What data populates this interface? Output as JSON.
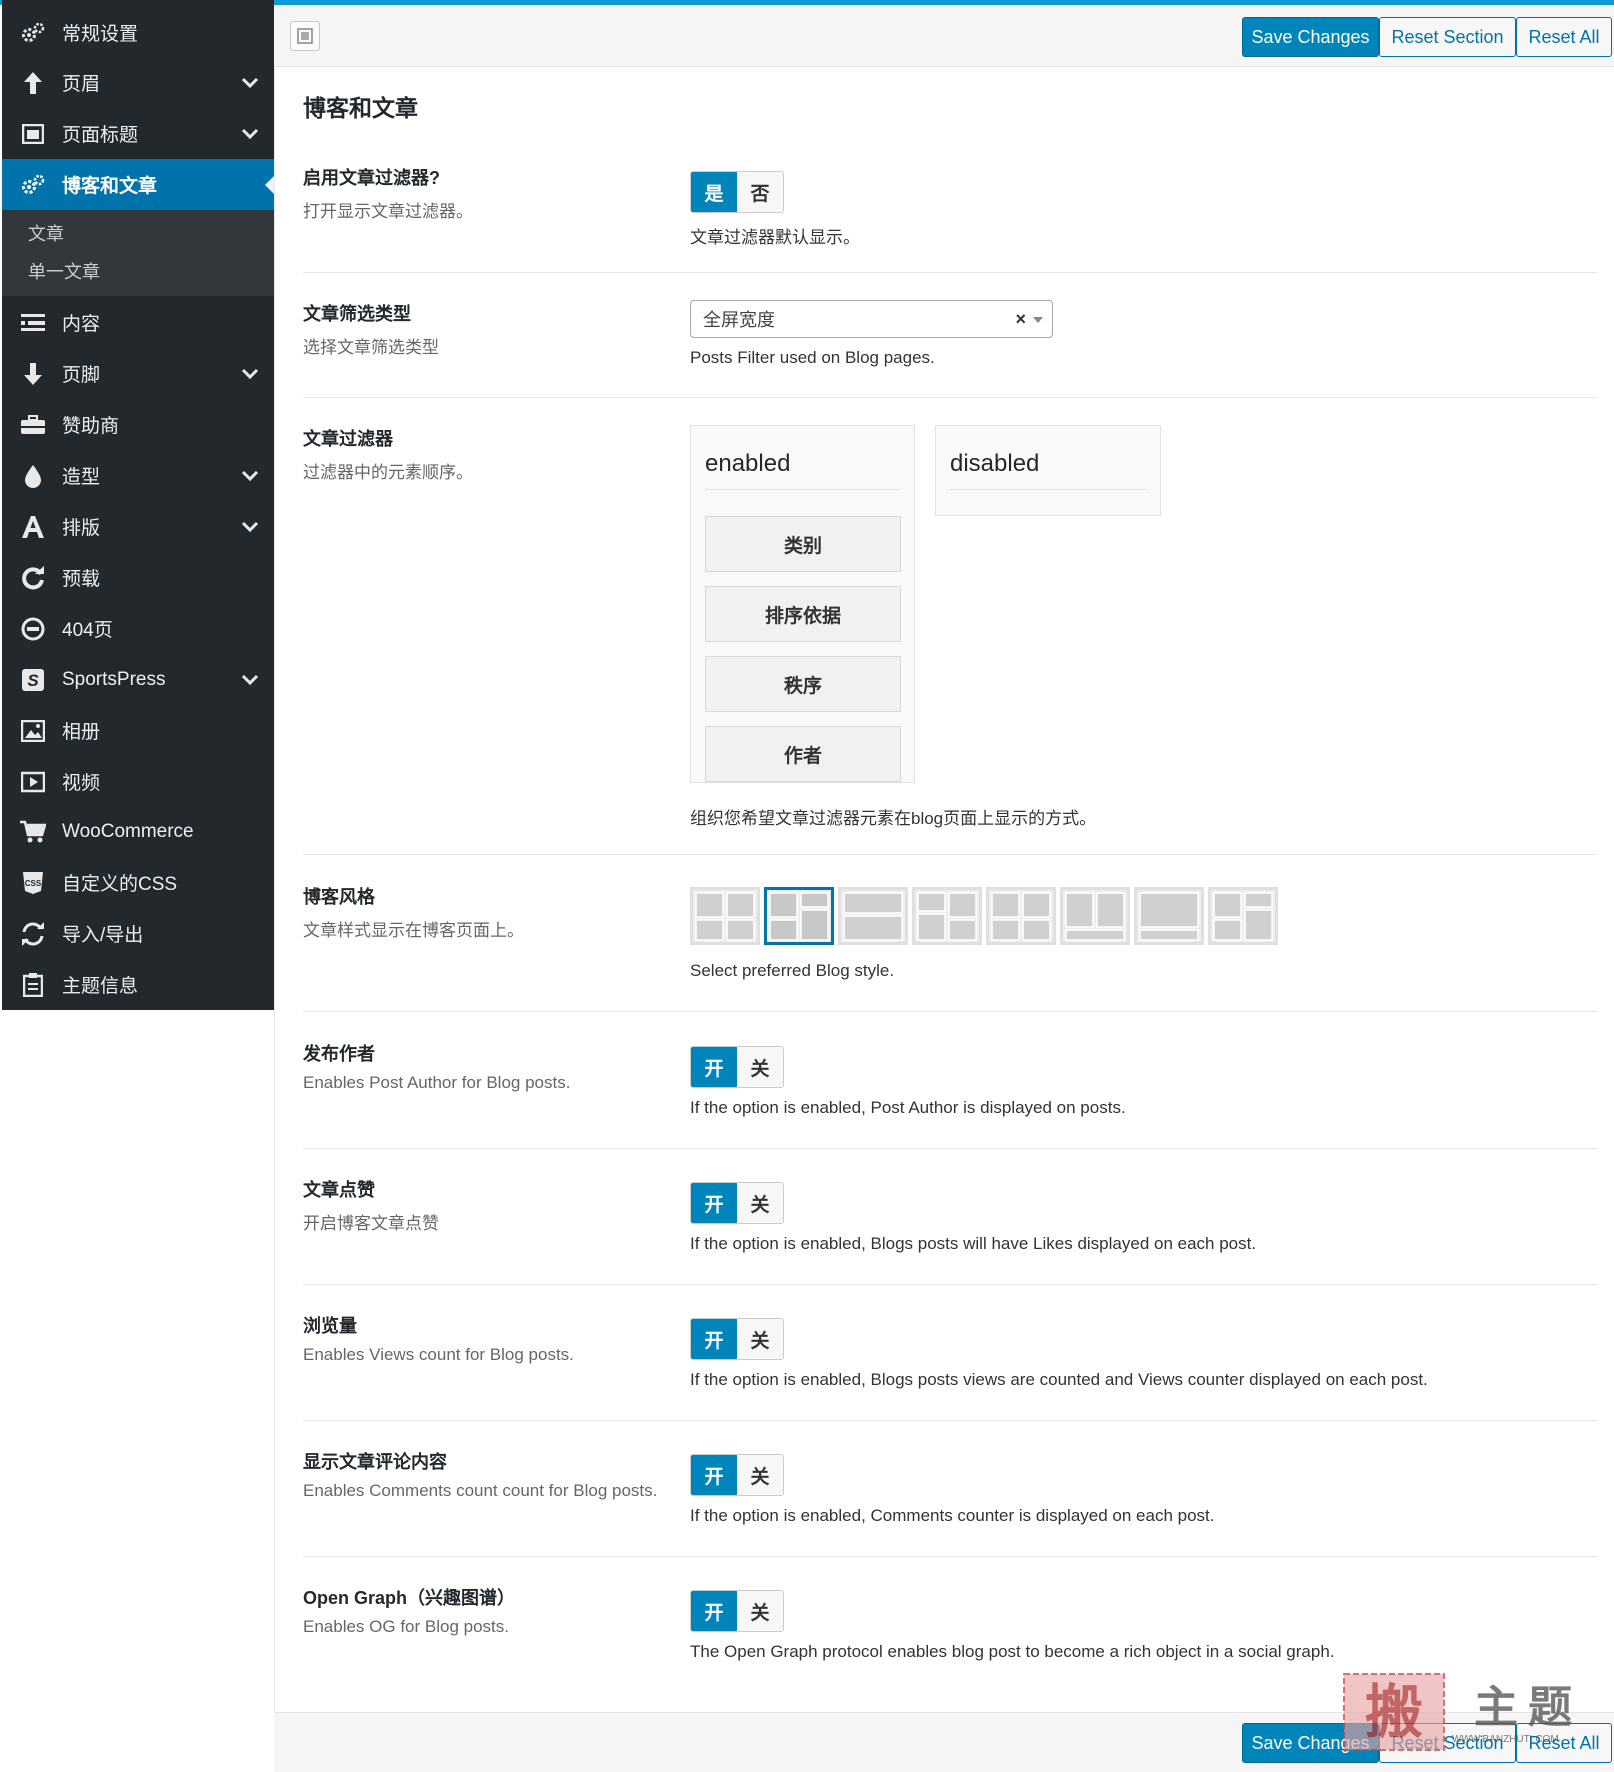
{
  "sidebar": {
    "items": [
      {
        "label": "常规设置",
        "icon": "gears-icon"
      },
      {
        "label": "页眉",
        "icon": "arrow-up-icon"
      },
      {
        "label": "页面标题",
        "icon": "window-icon"
      },
      {
        "label": "博客和文章",
        "icon": "gears-icon"
      },
      {
        "label": "内容",
        "icon": "list-icon"
      },
      {
        "label": "页脚",
        "icon": "arrow-down-icon"
      },
      {
        "label": "赞助商",
        "icon": "briefcase-icon"
      },
      {
        "label": "造型",
        "icon": "drop-icon"
      },
      {
        "label": "排版",
        "icon": "typography-icon"
      },
      {
        "label": "预载",
        "icon": "refresh-icon"
      },
      {
        "label": "404页",
        "icon": "minus-circle-icon"
      },
      {
        "label": "SportsPress",
        "icon": "sportspress-icon"
      },
      {
        "label": "相册",
        "icon": "image-icon"
      },
      {
        "label": "视频",
        "icon": "play-icon"
      },
      {
        "label": "WooCommerce",
        "icon": "cart-icon"
      },
      {
        "label": "自定义的CSS",
        "icon": "css-icon"
      },
      {
        "label": "导入/导出",
        "icon": "sync-icon"
      },
      {
        "label": "主题信息",
        "icon": "clipboard-icon"
      }
    ],
    "submenu": [
      "文章",
      "单一文章"
    ]
  },
  "toolbar": {
    "save_label": "Save Changes",
    "reset_section_label": "Reset Section",
    "reset_all_label": "Reset All"
  },
  "section": {
    "title": "博客和文章",
    "options": [
      {
        "title": "启用文章过滤器?",
        "subtitle": "打开显示文章过滤器。",
        "desc": "文章过滤器默认显示。",
        "on_label": "是",
        "off_label": "否",
        "value": "是"
      },
      {
        "title": "文章筛选类型",
        "subtitle": "选择文章筛选类型",
        "desc": "Posts Filter used on Blog pages."
      },
      {
        "title": "文章过滤器",
        "subtitle": "过滤器中的元素顺序。",
        "desc": "组织您希望文章过滤器元素在blog页面上显示的方式。"
      },
      {
        "title": "博客风格",
        "subtitle": "文章样式显示在博客页面上。",
        "desc": "Select preferred Blog style."
      },
      {
        "title": "发布作者",
        "subtitle": "Enables Post Author for Blog posts.",
        "desc": "If the option is enabled, Post Author is displayed on posts.",
        "on_label": "开",
        "off_label": "关",
        "value": "开"
      },
      {
        "title": "文章点赞",
        "subtitle": "开启博客文章点赞",
        "desc": "If the option is enabled, Blogs posts will have Likes displayed on each post.",
        "on_label": "开",
        "off_label": "关",
        "value": "开"
      },
      {
        "title": "浏览量",
        "subtitle": "Enables Views count for Blog posts.",
        "desc": "If the option is enabled, Blogs posts views are counted and Views counter displayed on each post.",
        "on_label": "开",
        "off_label": "关",
        "value": "开"
      },
      {
        "title": "显示文章评论内容",
        "subtitle": "Enables Comments count count for Blog posts.",
        "desc": "If the option is enabled, Comments counter is displayed on each post.",
        "on_label": "开",
        "off_label": "关",
        "value": "开"
      },
      {
        "title": "Open Graph（兴趣图谱）",
        "subtitle": "Enables OG for Blog posts.",
        "desc": "The Open Graph protocol enables blog post to become a rich object in a social graph.",
        "on_label": "开",
        "off_label": "关",
        "value": "开"
      }
    ]
  },
  "filter_type": {
    "value": "全屏宽度",
    "clear": "×"
  },
  "sorter": {
    "enabled_title": "enabled",
    "disabled_title": "disabled",
    "enabled_items": [
      "类别",
      "排序依据",
      "秩序",
      "作者"
    ]
  },
  "blog_style": {
    "selected_index": 1,
    "option_count": 8
  },
  "colors": {
    "accent": "#0085ba",
    "sidebar_bg": "#23282d",
    "active_bg": "#0073aa"
  },
  "watermark": {
    "text": "搬主题",
    "url_text": "WWW.BANZHUTI.COM"
  }
}
